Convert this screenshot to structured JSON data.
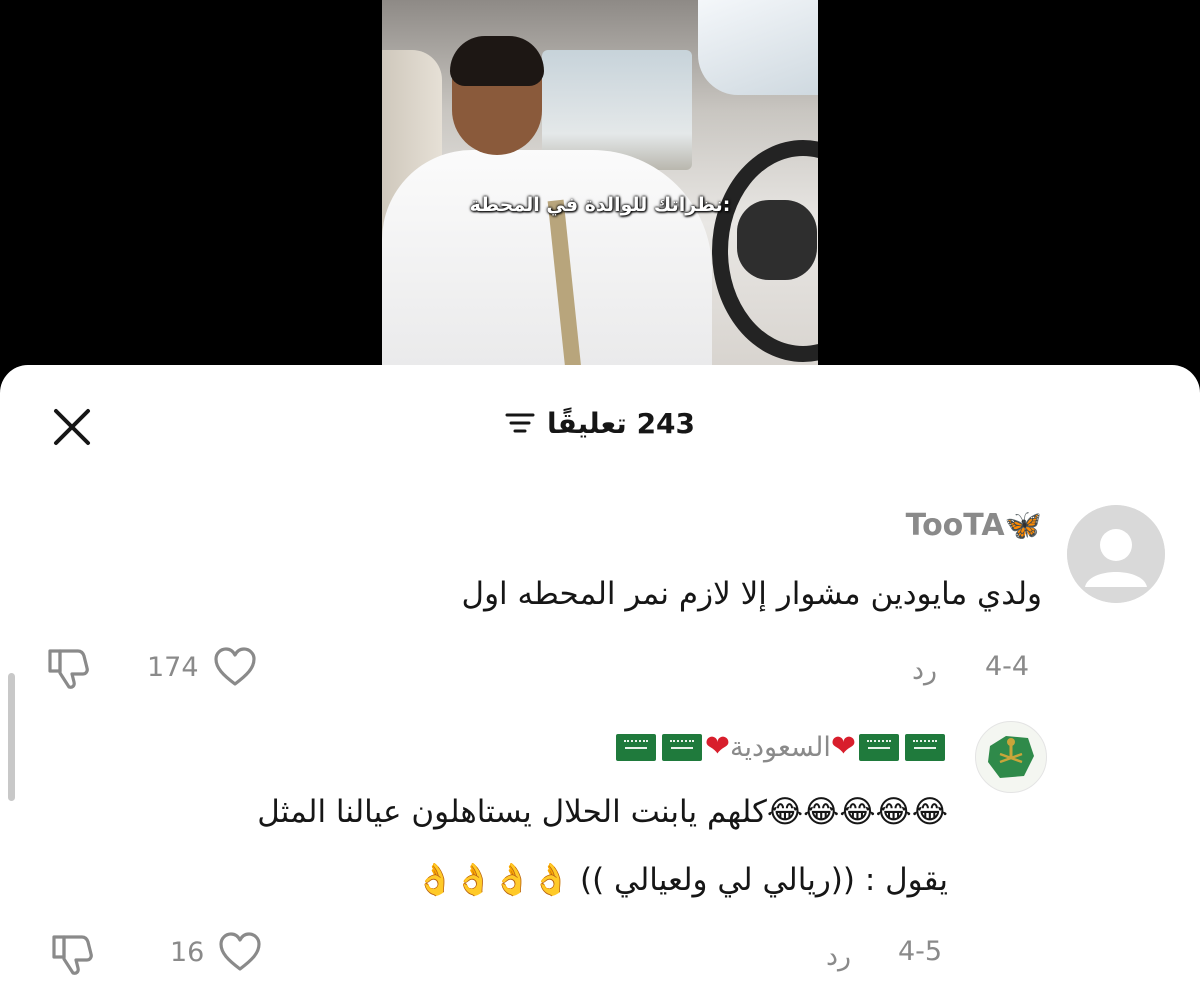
{
  "video": {
    "caption": "نظراتك للوالدة في المحطة:"
  },
  "header": {
    "title": "243 تعليقًا"
  },
  "comments": [
    {
      "username": "TooTA🦋",
      "text": "ولدي مايودين مشوار إلا لازم نمر المحطه اول",
      "date": "4-4",
      "reply_label": "رد",
      "likes": "174"
    },
    {
      "username_text": "السعودية",
      "username_icons": [
        "saudi-flag-icon",
        "saudi-flag-icon",
        "heart-emoji-icon",
        "saudi-flag-icon",
        "saudi-flag-icon"
      ],
      "line1": "😂😂😂😂😂كلهم يابنت الحلال يستاهلون عيالنا المثل",
      "line2": "يقول : ((ريالي لي ولعيالي )) 👌👌👌👌",
      "date": "4-5",
      "reply_label": "رد",
      "likes": "16"
    }
  ]
}
